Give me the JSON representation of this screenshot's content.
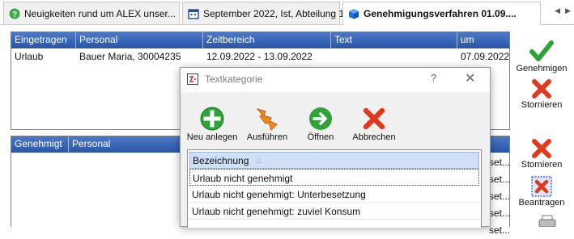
{
  "tabs": [
    {
      "label": "Neuigkeiten rund um ALEX unser...",
      "icon": "help-circle-icon"
    },
    {
      "label": "September 2022, Ist, Abteilung 1",
      "icon": "calendar-icon"
    },
    {
      "label": "Genehmigungsverfahren 01.09....",
      "icon": "cube-icon",
      "active": true
    }
  ],
  "tab_scroll": {
    "left": "◀",
    "right": "▶"
  },
  "top_grid": {
    "columns": [
      "Eingetragen",
      "Personal",
      "Zeitbereich",
      "Text",
      "um"
    ],
    "rows": [
      {
        "eingetragen": "Urlaub",
        "personal": "Bauer Maria, 30004235",
        "zeitbereich": "12.09.2022 - 13.09.2022",
        "text": "",
        "um": "07.09.2022"
      }
    ]
  },
  "bottom_grid": {
    "columns": [
      "Genehmigt",
      "Personal"
    ],
    "right_cells": [
      "set...",
      "set...",
      "set...",
      "set...",
      "set..."
    ]
  },
  "actions": {
    "approve_label": "Genehmigen",
    "cancel_label_1": "Stornieren",
    "cancel_label_2": "Stornieren",
    "request_label": "Beantragen"
  },
  "dialog": {
    "title": "Textkategorie",
    "help": "?",
    "close": "✕",
    "toolbar": {
      "new_label": "Neu anlegen",
      "execute_label": "Ausführen",
      "open_label": "Öffnen",
      "abort_label": "Abbrechen"
    },
    "list": {
      "header": "Bezeichnung",
      "sort_indicator": "△",
      "items": [
        "Urlaub nicht genehmigt",
        "Urlaub nicht genehmigt: Unterbesetzung",
        "Urlaub nicht genehmigt: zuviel Konsum"
      ]
    }
  },
  "colors": {
    "grid_header": "#2a55a6",
    "approve_green": "#2fa33a",
    "cancel_red": "#e03a1e"
  }
}
